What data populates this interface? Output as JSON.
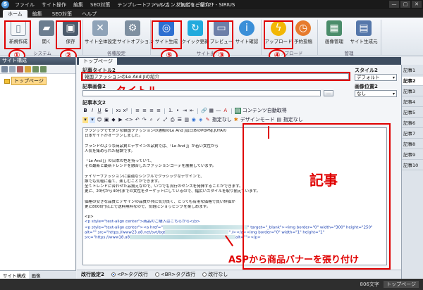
{
  "app": {
    "window_title": "ファッション人気店をご紹介 * - SIRIUS",
    "logo": "S",
    "menu": [
      "ファイル",
      "サイト操作",
      "編集",
      "SEO対策",
      "テンプレート",
      "ヘルプ",
      "プレビュー(F12)"
    ],
    "window_controls": [
      "—",
      "▢",
      "✕"
    ]
  },
  "ribbon_tabs": [
    "ホーム",
    "編集",
    "SEO対策",
    "ヘルプ"
  ],
  "ribbon": {
    "buttons": [
      {
        "id": "new",
        "label": "新規作成",
        "icon_color": "#f4f6f8"
      },
      {
        "id": "open",
        "label": "開く",
        "icon_color": "#6b7d8f"
      },
      {
        "id": "save",
        "label": "保存",
        "icon_color": "#4b5a6b"
      },
      {
        "id": "site-settings",
        "label": "サイト全体設定",
        "icon_color": "#8fa3b8"
      },
      {
        "id": "site-options",
        "label": "サイトオプション",
        "icon_color": "#7e8fa0"
      },
      {
        "id": "site-generate",
        "label": "サイト生成",
        "icon_color": "#2d6fd1"
      },
      {
        "id": "quick-update",
        "label": "クイック更新",
        "icon_color": "#22aadd"
      },
      {
        "id": "preview",
        "label": "プレビュー",
        "icon_color": "#6d7fa8"
      },
      {
        "id": "site-view",
        "label": "サイト確認",
        "icon_color": "#3a8fd8"
      },
      {
        "id": "upload",
        "label": "アップロード",
        "icon_color": "#f2b705"
      },
      {
        "id": "scheduled-upload",
        "label": "予約投稿",
        "icon_color": "#e67b2e"
      },
      {
        "id": "image-manager",
        "label": "画像管理",
        "icon_color": "#4a8c6a"
      },
      {
        "id": "site-generate-all",
        "label": "サイト生成元",
        "icon_color": "#5577aa"
      }
    ],
    "groups": [
      "システム",
      "各種設定",
      "サイト出力",
      "アップロード",
      "管理"
    ]
  },
  "annotations": {
    "circle_1": "①",
    "circle_2": "②",
    "circle_3": "③",
    "circle_4": "④",
    "circle_5": "⑤",
    "title_label": "タイトル",
    "article_label": "記事",
    "paste_label": "ASPから商品バナーを張り付け"
  },
  "left_panel": {
    "header": "サイト構成",
    "tree_item": "トップページ",
    "bottom_tabs": [
      "サイト構成",
      "画像"
    ]
  },
  "editor": {
    "tab_label": "トップページ",
    "title_label": "記事タイトル2",
    "title_value": "韓国ファッションのLe And JIの紹介",
    "image_label": "記事画像2",
    "body_label": "記事本文2",
    "contents_auto": "コンテンツ自動取得",
    "specify_label": "指定なし",
    "design_mode": "デザインモード",
    "style_label": "スタイル2",
    "style_value": "デフォルト",
    "image_pos_label": "画像位置2",
    "image_pos_value": "なし",
    "body_lines": [
      "クラシックでモダンな韓国ファッションの通販のLe And Jは日本のPOPNJ.JUYAの",
      "日本サイトがオープンしました。",
      "",
      "ブランドのような商品質とデザインの品質では、「Le And J」が若い女性から",
      "人気を集められた秘訣です。",
      "",
      "「Le And J」の日本の色を持っていて、",
      "その最新と最新トレンドを融合したファッションコーデを展開しています。",
      "",
      "デイリーファッションに最適なシンプルでクラシックなデザインで、",
      "誰でも気軽に着て、楽しむことができます。",
      "全てトレンドに合わせた品揃えなので、いつでも流行のセンスを発揮することができます。",
      "更に、20代から40代までの女性をターゲットにしているので、幅広いスタイルを取り揃えています。",
      "",
      "価格の安さな品質とデザインの品質が共に気分良く、とっても有用な価格で良い評価が",
      "更に8000円以上で送料無料なので、気軽にショッピングを楽しめます。",
      "",
      "<p>"
    ],
    "code_line_1": "<p style=\"text-align:center\">商品のご購入はこちらから</p>",
    "code_line_2a": "<p style=\"text-align:center\"><a href=\"",
    "code_line_2b": "\" target=\"_blank\"><img border=\"0\" width=\"300\" height=\"250\"",
    "code_line_3a": "alt=\"\" src=\"https://www23.a8.net/svt/bgt",
    "code_line_3b": "\" /></a><img border=\"0\" width=\"1\" height=\"1\"",
    "code_line_4a": "src=\"https://www18.a8",
    "code_line_4b": "alt=\"\"></p>"
  },
  "right_panel": {
    "tabs": [
      "記事1",
      "記事2",
      "記事3",
      "記事4",
      "記事5",
      "記事6",
      "記事7",
      "記事8",
      "記事9",
      "記事10"
    ]
  },
  "bottom": {
    "label": "改行設定2",
    "options": [
      "<P>タグ改行",
      "<BR>タグ改行",
      "改行なし"
    ]
  },
  "status": {
    "chars": "806文字",
    "page": "トップページ"
  }
}
